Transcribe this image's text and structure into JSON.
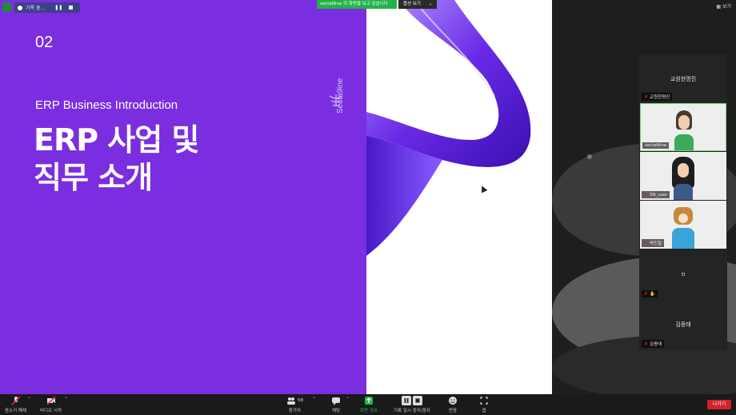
{
  "top": {
    "recording_text": "기록 중...",
    "share_notice": "sectaNine 의 화면을 보고 있습니다",
    "view_options": "옵션 보기",
    "view_button": "보기"
  },
  "slide": {
    "number": "02",
    "subtitle": "ERP Business Introduction",
    "title_line1": "ERP 사업 및",
    "title_line2": "직무 소개",
    "brand": "Secta9ine",
    "accent_color": "#7a2ee0"
  },
  "gallery": {
    "tiles": [
      {
        "center_name": "교원현명진",
        "label": "교원현명진"
      },
      {
        "label": "sectaNine"
      },
      {
        "label": "SN_user"
      },
      {
        "label": "박민철"
      },
      {
        "center_name": "ㅁ",
        "label": ""
      },
      {
        "center_name": "김종태",
        "label": "김종태"
      }
    ]
  },
  "toolbar": {
    "unmute": "음소거 해제",
    "start_video": "비디오 시작",
    "participants": "참가자",
    "participants_count": "58",
    "chat": "채팅",
    "share_screen": "화면 공유",
    "pause_recording": "기록 일시 중지/중지",
    "reactions": "반응",
    "apps": "앱",
    "leave": "나가기"
  }
}
